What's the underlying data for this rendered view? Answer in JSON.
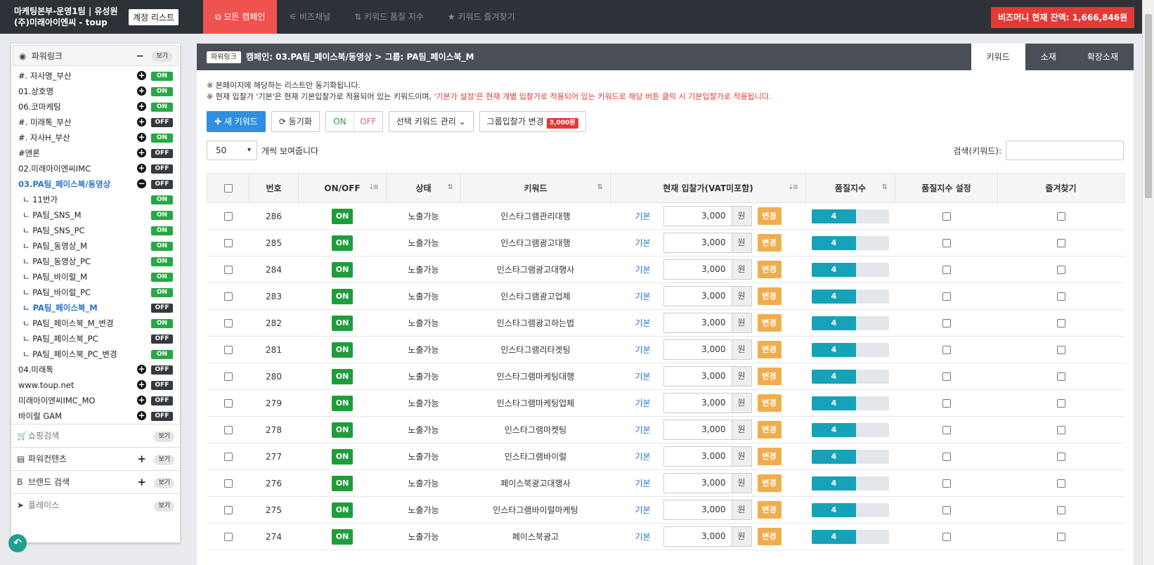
{
  "topbar": {
    "account_line1": "마케팅본부-운영1팀 | 유성원",
    "account_line2": "(주)미래아이엔씨 - toup",
    "account_list_button": "계정 리스트",
    "nav": [
      {
        "icon": "sitemap-icon",
        "glyph": "⧉",
        "label": "모든 캠페인",
        "active": true
      },
      {
        "icon": "channel-icon",
        "glyph": "⚟",
        "label": "비즈채널",
        "active": false
      },
      {
        "icon": "sort-icon",
        "glyph": "⇅",
        "label": "키워드 품질 지수",
        "active": false
      },
      {
        "icon": "star-icon",
        "glyph": "★",
        "label": "키워드 즐겨찾기",
        "active": false
      }
    ],
    "balance": "비즈머니 현재 잔액: 1,666,846원"
  },
  "sidebar": {
    "header": {
      "label": "파워링크",
      "view": "보기"
    },
    "items": [
      {
        "label": "#. 자사명_부산",
        "status": "ON",
        "plus": true,
        "level": 0,
        "active": false
      },
      {
        "label": "01.상호명",
        "status": "ON",
        "plus": true,
        "level": 0,
        "active": false
      },
      {
        "label": "06.코마케팅",
        "status": "ON",
        "plus": true,
        "level": 0,
        "active": false
      },
      {
        "label": "#. 미래톡_부산",
        "status": "OFF",
        "plus": true,
        "level": 0,
        "active": false
      },
      {
        "label": "#. 자사H_부산",
        "status": "ON",
        "plus": true,
        "level": 0,
        "active": false
      },
      {
        "label": "#앤론",
        "status": "OFF",
        "plus": true,
        "level": 0,
        "active": false
      },
      {
        "label": "02.미래아이엔씨IMC",
        "status": "OFF",
        "plus": true,
        "level": 0,
        "active": false
      },
      {
        "label": "03.PA팀_페이스북/동영상",
        "status": "OFF",
        "plus": false,
        "minus": true,
        "level": 0,
        "active": true
      },
      {
        "label": "ㄴ 11번가",
        "status": "ON",
        "level": 1,
        "active": false
      },
      {
        "label": "ㄴ PA팀_SNS_M",
        "status": "ON",
        "level": 1,
        "active": false
      },
      {
        "label": "ㄴ PA팀_SNS_PC",
        "status": "ON",
        "level": 1,
        "active": false
      },
      {
        "label": "ㄴ PA팀_동영상_M",
        "status": "ON",
        "level": 1,
        "active": false
      },
      {
        "label": "ㄴ PA팀_동영상_PC",
        "status": "ON",
        "level": 1,
        "active": false
      },
      {
        "label": "ㄴ PA팀_바이럴_M",
        "status": "ON",
        "level": 1,
        "active": false
      },
      {
        "label": "ㄴ PA팀_바이럴_PC",
        "status": "ON",
        "level": 1,
        "active": false
      },
      {
        "label": "ㄴ PA팀_페이스북_M",
        "status": "OFF",
        "level": 1,
        "active": true
      },
      {
        "label": "ㄴ PA팀_페이스북_M_변경",
        "status": "ON",
        "level": 1,
        "active": false
      },
      {
        "label": "ㄴ PA팀_페이스북_PC",
        "status": "OFF",
        "level": 1,
        "active": false
      },
      {
        "label": "ㄴ PA팀_페이스북_PC_변경",
        "status": "ON",
        "level": 1,
        "active": false
      },
      {
        "label": "04.미래톡",
        "status": "OFF",
        "plus": true,
        "level": 0,
        "active": false
      },
      {
        "label": "www.toup.net",
        "status": "OFF",
        "plus": true,
        "level": 0,
        "active": false
      },
      {
        "label": "미래아이엔씨IMC_MO",
        "status": "OFF",
        "plus": true,
        "level": 0,
        "active": false
      },
      {
        "label": "바이럴 GAM",
        "status": "OFF",
        "plus": true,
        "level": 0,
        "active": false
      }
    ],
    "sections": [
      {
        "icon": "cart-icon",
        "glyph": "🛒",
        "label": "쇼핑검색",
        "view": "보기",
        "plus": false,
        "muted": true
      },
      {
        "icon": "content-icon",
        "glyph": "▤",
        "label": "파워컨텐츠",
        "view": "보기",
        "plus": true,
        "muted": false
      },
      {
        "icon": "brand-icon",
        "glyph": "B",
        "label": "브랜드 검색",
        "view": "보기",
        "plus": true,
        "muted": false
      },
      {
        "icon": "place-icon",
        "glyph": "➤",
        "label": "플레이스",
        "view": "보기",
        "plus": false,
        "muted": true
      }
    ]
  },
  "main": {
    "badge": "파워링크",
    "breadcrumb": "캠페인: 03.PA팀_페이스북/동영상 > 그룹: PA팀_페이스북_M",
    "tabs": [
      "키워드",
      "소재",
      "확장소재"
    ],
    "notice1": "※ 본페이지에 해당하는 리스트만 동기화됩니다.",
    "notice2_a": "※ 현재 입찰가 '기본'은 현재 기본입찰가로 적용되어 있는 키워드이며, ",
    "notice2_b": "'기본가 설정'은 현재 개별 입찰가로 적용되어 있는 키워드로 해당 버튼 클릭 시 기본입찰가로 적용됩니다.",
    "toolbar": {
      "new_keyword": "새 키워드",
      "sync": "동기화",
      "on": "ON",
      "off": "OFF",
      "manage": "선택 키워드 관리",
      "group_bid": "그룹입찰가 변경",
      "group_bid_price": "3,000원"
    },
    "page_size": "50",
    "page_size_suffix": "개씩 보여줍니다",
    "search_label": "검색(키워드):",
    "search_value": "",
    "columns": [
      "번호",
      "ON/OFF",
      "상태",
      "키워드",
      "현재 입찰가(VAT미포함)",
      "품질지수",
      "품질지수 설정",
      "즐겨찾기"
    ],
    "bid_basic": "기본",
    "bid_unit": "원",
    "bid_change": "변경",
    "rows": [
      {
        "no": "286",
        "onoff": "ON",
        "state": "노출가능",
        "keyword": "인스타그램관리대행",
        "bid": "3,000",
        "quality": 4
      },
      {
        "no": "285",
        "onoff": "ON",
        "state": "노출가능",
        "keyword": "인스타그램광고대행",
        "bid": "3,000",
        "quality": 4
      },
      {
        "no": "284",
        "onoff": "ON",
        "state": "노출가능",
        "keyword": "인스타그램광고대행사",
        "bid": "3,000",
        "quality": 4
      },
      {
        "no": "283",
        "onoff": "ON",
        "state": "노출가능",
        "keyword": "인스타그램광고업체",
        "bid": "3,000",
        "quality": 4
      },
      {
        "no": "282",
        "onoff": "ON",
        "state": "노출가능",
        "keyword": "인스타그램광고하는법",
        "bid": "3,000",
        "quality": 4
      },
      {
        "no": "281",
        "onoff": "ON",
        "state": "노출가능",
        "keyword": "인스타그램리타겟팅",
        "bid": "3,000",
        "quality": 4
      },
      {
        "no": "280",
        "onoff": "ON",
        "state": "노출가능",
        "keyword": "인스타그램마케팅대행",
        "bid": "3,000",
        "quality": 4
      },
      {
        "no": "279",
        "onoff": "ON",
        "state": "노출가능",
        "keyword": "인스타그램마케팅업체",
        "bid": "3,000",
        "quality": 4
      },
      {
        "no": "278",
        "onoff": "ON",
        "state": "노출가능",
        "keyword": "인스타그램마켓팅",
        "bid": "3,000",
        "quality": 4
      },
      {
        "no": "277",
        "onoff": "ON",
        "state": "노출가능",
        "keyword": "인스타그램바이럴",
        "bid": "3,000",
        "quality": 4
      },
      {
        "no": "276",
        "onoff": "ON",
        "state": "노출가능",
        "keyword": "페이스북광고대행사",
        "bid": "3,000",
        "quality": 4
      },
      {
        "no": "275",
        "onoff": "ON",
        "state": "노출가능",
        "keyword": "인스타그램바이럴마케팅",
        "bid": "3,000",
        "quality": 4
      },
      {
        "no": "274",
        "onoff": "ON",
        "state": "노출가능",
        "keyword": "페이스북광고",
        "bid": "3,000",
        "quality": 4
      }
    ],
    "quality_max": 7
  },
  "colors": {
    "topbar": "#2d3239",
    "active_nav": "#ef5350",
    "balance": "#e53935",
    "on": "#28a745",
    "off": "#343a40",
    "quality": "#16a2b8",
    "change": "#f0ad4e",
    "primary": "#2f8fe0"
  }
}
